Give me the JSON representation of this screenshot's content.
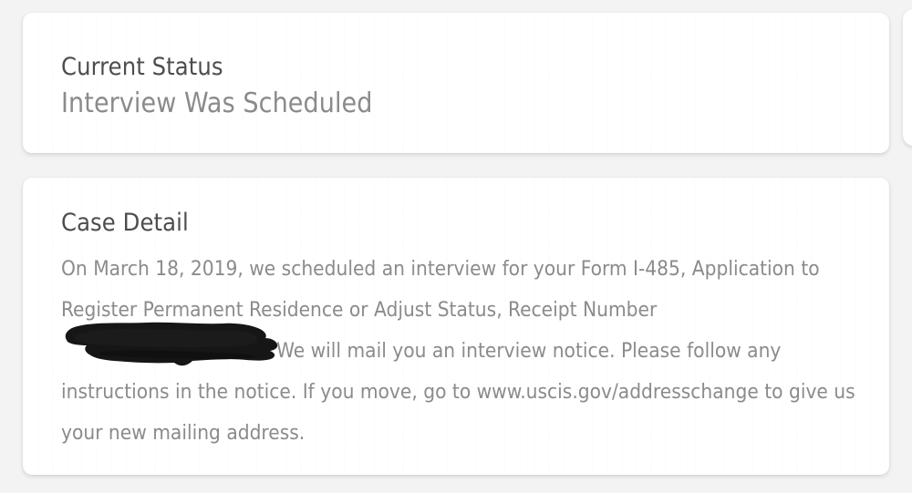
{
  "background_color": "#f3f3f4",
  "card_color": "#ffffff",
  "heading_color": "#4d4d4f",
  "body_color": "#8b8b8e",
  "redaction_color": "#161616",
  "status_card": {
    "title": "Current Status",
    "value": "Interview Was Scheduled"
  },
  "detail_card": {
    "title": "Case Detail",
    "body_before_redaction": "On March 18, 2019, we scheduled an interview for your Form I-485, Application to Register Permanent Residence or Adjust Status, Receipt Number ",
    "redacted_label": "receipt-number-redacted",
    "body_after_redaction": "We will mail you an interview notice. Please follow any instructions in the notice. If you move, go to www.uscis.gov/addresschange to give us your new mailing address.",
    "url_text": "www.uscis.gov/addresschange",
    "date_text": "March 18, 2019",
    "form_number": "I-485"
  },
  "carousel": {
    "next_card_peek_label": "next-card"
  }
}
